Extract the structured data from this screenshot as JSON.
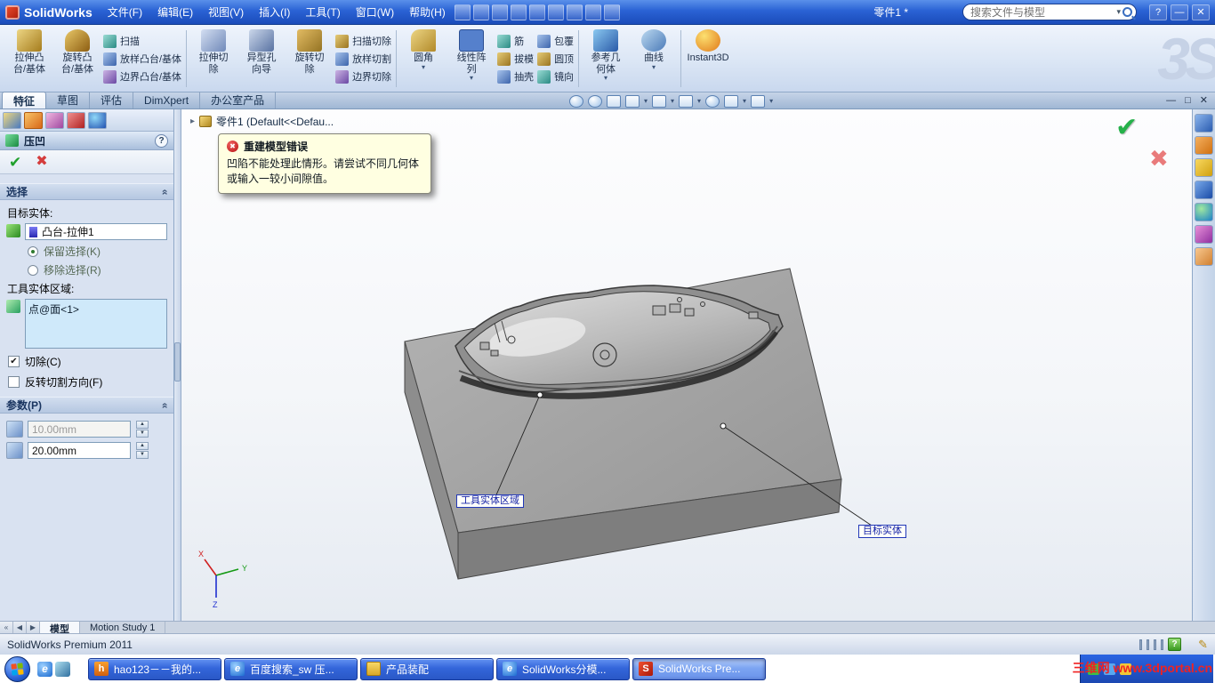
{
  "icons": {
    "check": "✔",
    "cross": "✖",
    "dropdown": "▾",
    "help": "?",
    "pencil": "✎",
    "section_chevron": "»",
    "expander": "▸",
    "nav_first": "«",
    "nav_prev": "◀",
    "nav_next": "▶",
    "minimize": "—",
    "restore": "□",
    "close": "✕",
    "spin_up": "▲",
    "spin_down": "▼",
    "ie_glyph": "e",
    "hao_glyph": "h",
    "sw_glyph": "S"
  },
  "titlebar": {
    "app_name": "SolidWorks",
    "doc_title": "零件1 *",
    "search_placeholder": "搜索文件与模型"
  },
  "menu": [
    "文件(F)",
    "编辑(E)",
    "视图(V)",
    "插入(I)",
    "工具(T)",
    "窗口(W)",
    "帮助(H)"
  ],
  "ribbon": {
    "watermark": "3S",
    "large": [
      {
        "label": "拉伸凸\n台/基体"
      },
      {
        "label": "旋转凸\n台/基体"
      },
      {
        "label": "拉伸切\n除"
      },
      {
        "label": "异型孔\n向导"
      },
      {
        "label": "旋转切\n除"
      },
      {
        "label": "圆角"
      },
      {
        "label": "线性阵\n列"
      },
      {
        "label": "参考几\n何体"
      },
      {
        "label": "曲线"
      },
      {
        "label": "Instant3D"
      }
    ],
    "small": [
      "扫描",
      "放样凸台/基体",
      "边界凸台/基体",
      "扫描切除",
      "放样切割",
      "边界切除",
      "筋",
      "拔模",
      "抽壳",
      "包覆",
      "圆顶",
      "镜向"
    ]
  },
  "command_tabs": {
    "items": [
      "特征",
      "草图",
      "评估",
      "DimXpert",
      "办公室产品"
    ]
  },
  "feature_tree": {
    "root": "零件1  (Default<<Defau..."
  },
  "error_popup": {
    "title": "重建模型错误",
    "message": "凹陷不能处理此情形。请尝试不同几何体或输入一较小间隙值。"
  },
  "property_panel": {
    "title": "压凹",
    "selection": {
      "header": "选择",
      "target_label": "目标实体:",
      "target_value": "凸台-拉伸1",
      "radio_keep": "保留选择(K)",
      "radio_remove": "移除选择(R)",
      "tool_label": "工具实体区域:",
      "tool_item": "点@面<1>",
      "check_cut": "切除(C)",
      "check_flip": "反转切割方向(F)"
    },
    "parameters": {
      "header": "参数(P)",
      "gap_value": "10.00mm",
      "thickness_value": "20.00mm"
    }
  },
  "graphics": {
    "tool_label": "工具实体区域",
    "target_label": "目标实体",
    "triad": {
      "x": "X",
      "y": "Y",
      "z": "Z"
    }
  },
  "bottom_tabs": {
    "model": "模型",
    "motion": "Motion Study 1"
  },
  "statusbar": {
    "text": "SolidWorks Premium 2011"
  },
  "taskbar": {
    "buttons": [
      {
        "label": "hao123－－我的..."
      },
      {
        "label": "百度搜索_sw 压..."
      },
      {
        "label": "产品装配"
      },
      {
        "label": "SolidWorks分模..."
      },
      {
        "label": "SolidWorks Pre..."
      }
    ],
    "watermark": "三维网 www.3dportal.cn"
  },
  "colors": {
    "titlebar_blue": "#2a62d4",
    "ribbon_bg": "#dbe6f5",
    "panel_bg": "#d9e2f1",
    "listbox_blue": "#cfe9fa",
    "taskbar_blue": "#1e4ec3",
    "error_bg": "#ffffe1",
    "ok_green": "#1fa02c",
    "cancel_red": "#d43c3c",
    "watermark_red": "#f02222"
  }
}
